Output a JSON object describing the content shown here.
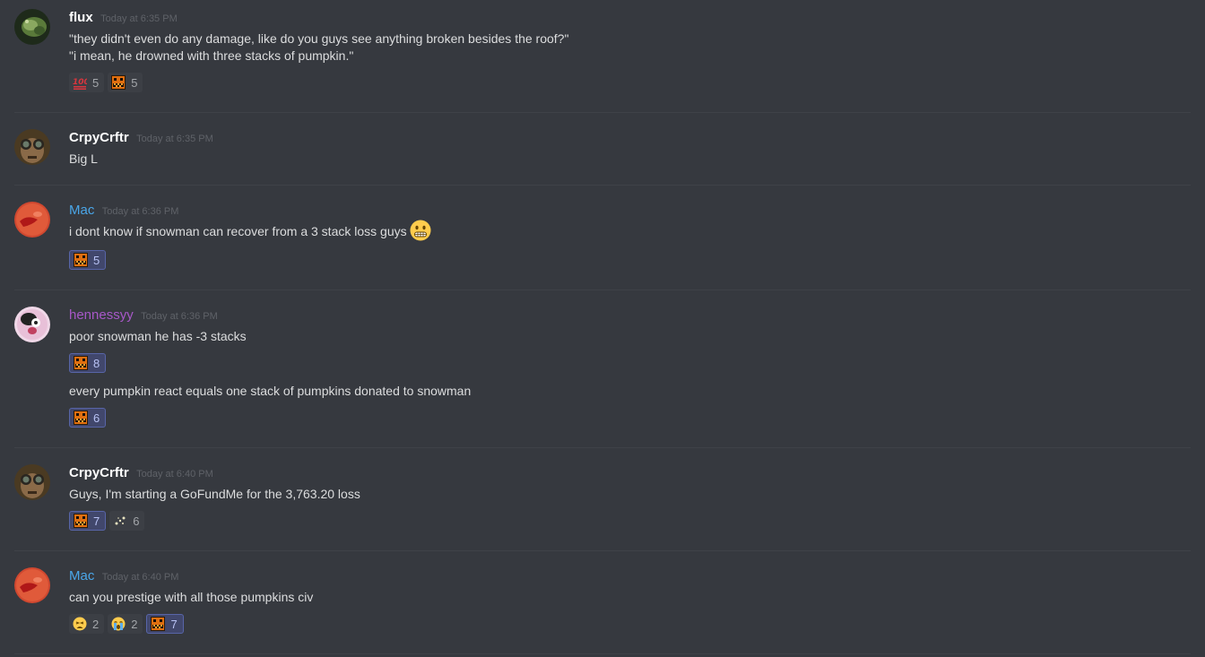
{
  "messages": [
    {
      "username": "flux",
      "timestamp": "Today at 6:35 PM",
      "lines": [
        "\"they didn't even do any damage, like do you guys see anything broken besides the roof?\"",
        "\"i mean, he drowned with three stacks of pumpkin.\""
      ],
      "reactions": [
        {
          "icon": "hundred-points-icon",
          "count": "5"
        },
        {
          "icon": "pumpkin-emote-icon",
          "count": "5"
        }
      ]
    },
    {
      "username": "CrpyCrftr",
      "timestamp": "Today at 6:35 PM",
      "lines": [
        "Big L"
      ]
    },
    {
      "username": "Mac",
      "timestamp": "Today at 6:36 PM",
      "lines": [
        "i dont know if snowman can recover from a 3 stack loss guys"
      ],
      "inline_emoji": "grimacing-face-icon",
      "reactions": [
        {
          "icon": "pumpkin-emote-icon",
          "count": "5"
        }
      ]
    },
    {
      "username": "hennessyy",
      "timestamp": "Today at 6:36 PM",
      "lines": [
        "poor snowman he has -3 stacks"
      ],
      "reactions": [
        {
          "icon": "pumpkin-emote-icon",
          "count": "8"
        }
      ],
      "followup": {
        "text": "every pumpkin react equals one stack of pumpkins donated to snowman",
        "reactions": [
          {
            "icon": "pumpkin-emote-icon",
            "count": "6"
          }
        ]
      }
    },
    {
      "username": "CrpyCrftr",
      "timestamp": "Today at 6:40 PM",
      "lines": [
        "Guys, I'm starting a GoFundMe for the 3,763.20 loss"
      ],
      "reactions": [
        {
          "icon": "pumpkin-emote-icon",
          "count": "7"
        },
        {
          "icon": "sparkle-emote-icon",
          "count": "6"
        }
      ]
    },
    {
      "username": "Mac",
      "timestamp": "Today at 6:40 PM",
      "lines": [
        "can you prestige with all those pumpkins civ"
      ],
      "reactions": [
        {
          "icon": "tired-face-icon",
          "count": "2"
        },
        {
          "icon": "crying-face-icon",
          "count": "2"
        },
        {
          "icon": "pumpkin-emote-icon",
          "count": "7"
        }
      ]
    }
  ],
  "colors": {
    "background": "#36393f",
    "text": "#dcddde",
    "username_default": "#ffffff",
    "username_mac": "#4aa6e8",
    "username_hennessyy": "#a758c8",
    "timestamp": "#5f6268",
    "reaction_bg": "#3c3f45",
    "reaction_me_bg": "#41476c"
  }
}
